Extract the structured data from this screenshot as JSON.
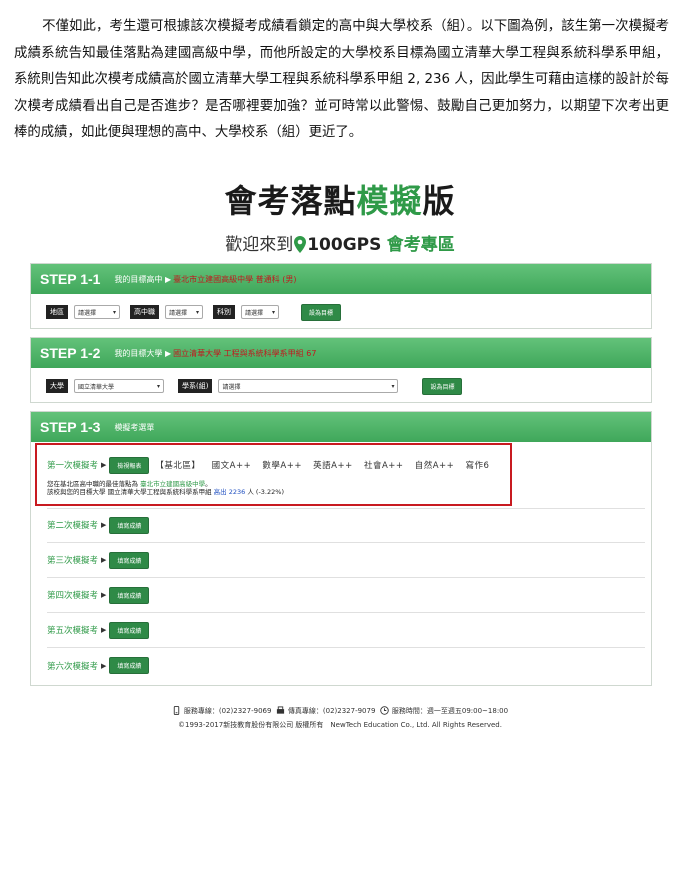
{
  "paragraph": "不僅如此，考生還可根據該次模擬考成績看鎖定的高中與大學校系（組）。以下圖為例，該生第一次模擬考成績系統告知最佳落點為建國高級中學，而他所設定的大學校系目標為國立清華大學工程與系統科學系甲組，系統則告知此次模考成績高於國立清華大學工程與系統科學系甲組 2, 236 人，因此學生可藉由這樣的設計於每次模考成績看出自己是否進步？是否哪裡要加強？並可時常以此警惕、鼓勵自己更加努力，以期望下次考出更棒的成績，如此便與理想的高中、大學校系（組）更近了。",
  "title": {
    "part1": "會考落點",
    "part2": "模擬",
    "part3": "版"
  },
  "subtitle": {
    "welcome": "歡迎來到",
    "brand": "100GPS",
    "zone": "會考專區"
  },
  "step1": {
    "number": "STEP 1-1",
    "label": "我的目標高中 ▶",
    "value": "臺北市立建國高級中學 普通科 (男)",
    "filters": [
      {
        "label": "地區",
        "select": "請選擇"
      },
      {
        "label": "高中職",
        "select": "請選擇"
      },
      {
        "label": "科別",
        "select": "請選擇"
      }
    ],
    "button": "設為目標"
  },
  "step2": {
    "number": "STEP 1-2",
    "label": "我的目標大學 ▶",
    "value": "國立清華大學 工程與系統科學系甲組 67",
    "filters": [
      {
        "label": "大學",
        "select": "國立清華大學"
      },
      {
        "label": "學系(組)",
        "select": "請選擇"
      }
    ],
    "button": "設為目標"
  },
  "step3": {
    "number": "STEP 1-3",
    "label": "模擬考選單",
    "first": {
      "name": "第一次模擬考",
      "button": "檢視報表",
      "region": "【基北區】",
      "scores": [
        "國文A++",
        "數學A++",
        "英語A++",
        "社會A++",
        "自然A++",
        "寫作6"
      ],
      "line1_prefix": "您在基北區高中職的最佳落點為",
      "line1_school": "臺北市立建國高級中學",
      "line1_suffix": "。",
      "line2_prefix": "該校與您的目標大學 國立清華大學工程與系統科學系甲組",
      "line2_value": "高出 2236",
      "line2_suffix": "人 (-3.22%)"
    },
    "others": [
      {
        "name": "第二次模擬考",
        "button": "填寫成績"
      },
      {
        "name": "第三次模擬考",
        "button": "填寫成績"
      },
      {
        "name": "第四次模擬考",
        "button": "填寫成績"
      },
      {
        "name": "第五次模擬考",
        "button": "填寫成績"
      },
      {
        "name": "第六次模擬考",
        "button": "填寫成績"
      }
    ]
  },
  "footer": {
    "phone": "服務專線：(02)2327-9069",
    "fax": "傳真專線：(02)2327-9079",
    "hours": "服務時間：週一至週五09:00~18:00",
    "copyright": "©1993-2017新技教育股份有限公司 版權所有　NewTech Education Co., Ltd. All Rights Reserved."
  },
  "colors": {
    "green": "#3fa75a",
    "red": "#c81a20",
    "dark_green_button": "#2f8a47"
  }
}
